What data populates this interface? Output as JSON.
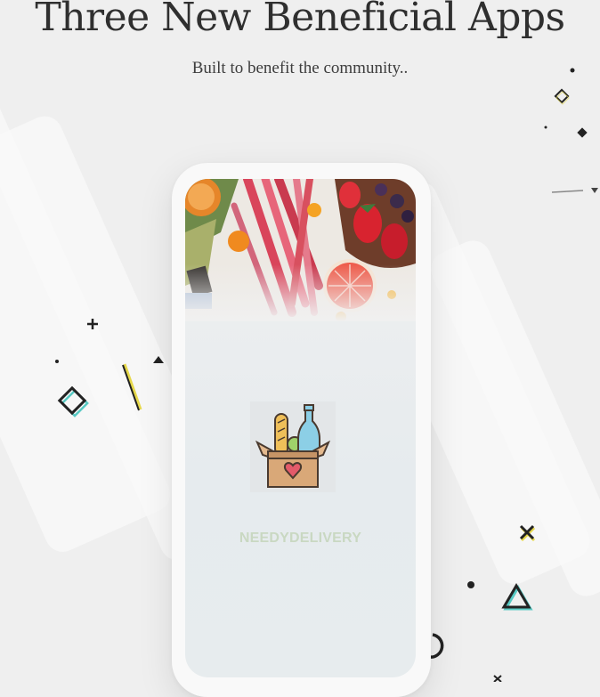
{
  "header": {
    "title": "Three New Beneficial Apps",
    "subtitle": "Built to benefit the community.."
  },
  "phone": {
    "app_name": "NEEDYDELIVERY",
    "app_name_color": "#c9d8c2",
    "logo_icon": "grocery-box-heart-icon",
    "hero_image": "fresh-produce-photo"
  },
  "decorations": [
    "diamond-icon",
    "plus-icon",
    "triangle-icon",
    "cross-icon",
    "dot-icon",
    "ring-icon",
    "line-icon"
  ]
}
